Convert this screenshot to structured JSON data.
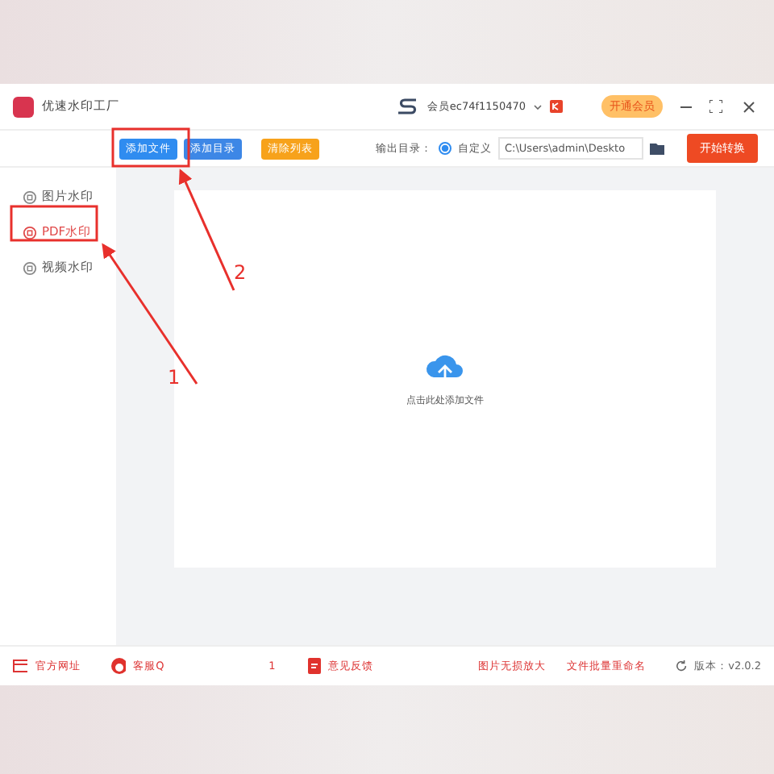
{
  "app": {
    "title": "优速水印工厂"
  },
  "account": {
    "user": "会员ec74f1150470",
    "vip_button": "开通会员"
  },
  "toolbar": {
    "buttons": [
      {
        "label": "添加文件",
        "color": "#2f8cf0"
      },
      {
        "label": "添加目录",
        "color": "#3d87e6"
      },
      {
        "label": "清除列表",
        "color": "#f7a21b"
      }
    ],
    "output_label": "输出目录：",
    "radio": {
      "label": "自定义",
      "selected": true
    },
    "path": "C:\\Users\\admin\\Deskto",
    "start_button": "开始转换"
  },
  "sidebar": {
    "items": [
      {
        "label": "图片水印",
        "selected": false
      },
      {
        "label": "PDF水印",
        "selected": true
      },
      {
        "label": "视频水印",
        "selected": false
      }
    ]
  },
  "dropzone": {
    "hint": "点击此处添加文件"
  },
  "footer": {
    "website": "官方网址",
    "service": "客服Q",
    "service_tail": "1",
    "feedback": "意见反馈",
    "links": [
      "图片无损放大",
      "文件批量重命名"
    ],
    "version": "版本：v2.0.2"
  },
  "annotations": [
    {
      "label": "1"
    },
    {
      "label": "2"
    }
  ]
}
